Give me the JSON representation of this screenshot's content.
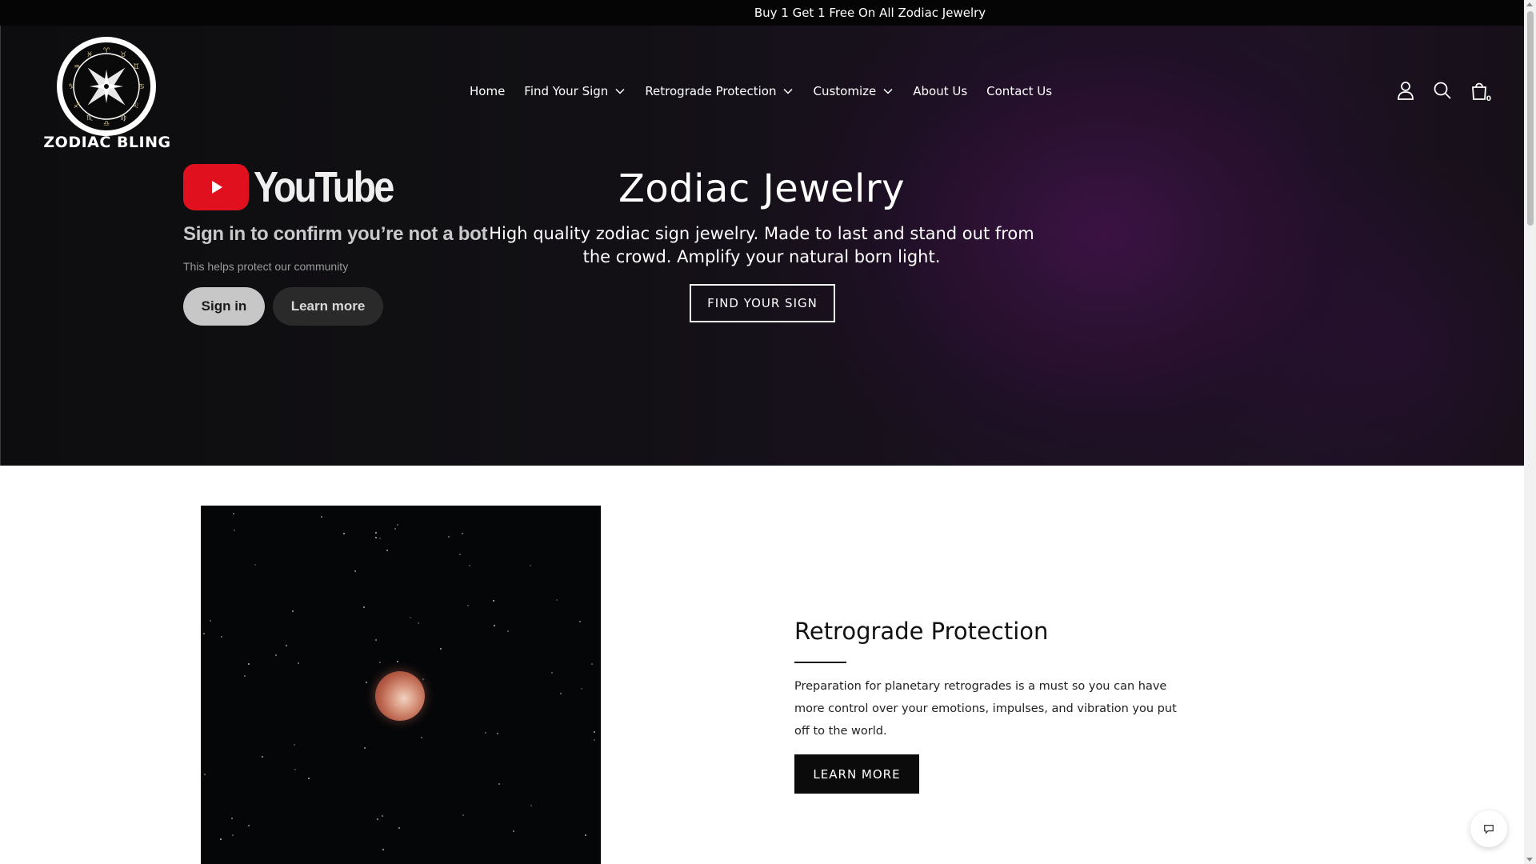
{
  "announcement": {
    "text": "Buy 1 Get 1 Free On All Zodiac Jewelry"
  },
  "logo": {
    "text": "ZODIAC BLING",
    "icon": "zodiac-wheel-logo"
  },
  "nav": {
    "home": "Home",
    "find_sign": "Find Your Sign",
    "retrograde": "Retrograde Protection",
    "customize": "Customize",
    "about": "About Us",
    "contact": "Contact Us"
  },
  "header_icons": {
    "account": "user-icon",
    "search": "search-icon",
    "cart": "cart-icon",
    "cart_count": "0"
  },
  "youtube_overlay": {
    "logo_text": "YouTube",
    "title": "Sign in to confirm you’re not a bot",
    "subtitle": "This helps protect our community",
    "sign_in": "Sign in",
    "learn_more": "Learn more"
  },
  "hero": {
    "title": "Zodiac Jewelry",
    "subtitle": "High quality zodiac sign jewelry. Made to last and stand out from the crowd. Amplify your natural born light.",
    "button": "FIND YOUR SIGN"
  },
  "retrograde_section": {
    "title": "Retrograde Protection",
    "text": "Preparation for planetary retrogrades is a must so you can have more control over your emotions, impulses, and vibration you put off to the world.",
    "button": "LEARN MORE",
    "image": "blood-moon-night-sky"
  },
  "chat": {
    "icon": "chat-bubble-icon"
  },
  "colors": {
    "announcement_bg": "#050505",
    "hero_bg": "#121014",
    "hero_glow": "#46124e",
    "youtube_red": "#e0101e",
    "button_dark": "#0b0b0b"
  }
}
